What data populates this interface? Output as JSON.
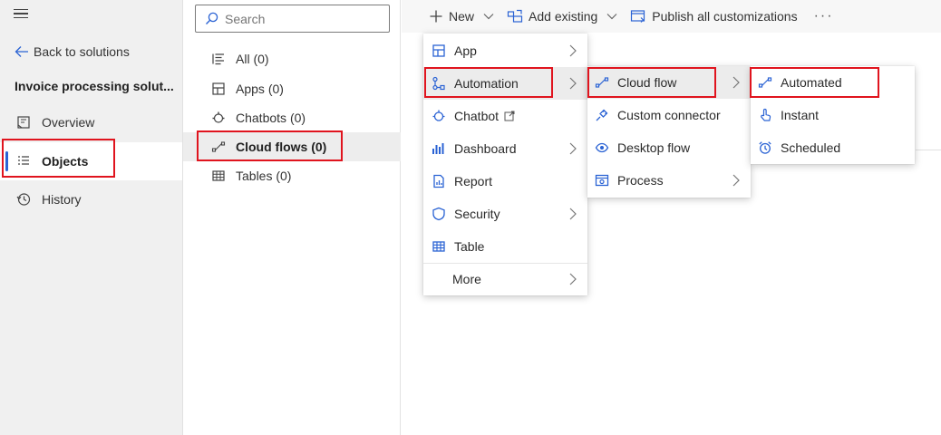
{
  "leftnav": {
    "back_label": "Back to solutions",
    "solution_title": "Invoice processing solut...",
    "items": [
      {
        "label": "Overview",
        "icon": "overview-icon"
      },
      {
        "label": "Objects",
        "icon": "objects-icon",
        "active": true
      },
      {
        "label": "History",
        "icon": "history-icon"
      }
    ]
  },
  "objects": {
    "search_placeholder": "Search",
    "items": [
      {
        "label": "All",
        "count": "(0)",
        "icon": "list-icon"
      },
      {
        "label": "Apps",
        "count": "(0)",
        "icon": "app-icon"
      },
      {
        "label": "Chatbots",
        "count": "(0)",
        "icon": "chatbot-icon"
      },
      {
        "label": "Cloud flows",
        "count": "(0)",
        "icon": "cloud-flow-icon",
        "active": true
      },
      {
        "label": "Tables",
        "count": "(0)",
        "icon": "table-icon"
      }
    ]
  },
  "commandbar": {
    "new_label": "New",
    "add_existing_label": "Add existing",
    "publish_label": "Publish all customizations",
    "more_label": "···"
  },
  "menu_new": {
    "items": [
      {
        "label": "App",
        "submenu": true
      },
      {
        "label": "Automation",
        "submenu": true,
        "highlighted": true
      },
      {
        "label": "Chatbot",
        "external": true
      },
      {
        "label": "Dashboard",
        "submenu": true
      },
      {
        "label": "Report"
      },
      {
        "label": "Security",
        "submenu": true
      },
      {
        "label": "Table"
      },
      {
        "label": "More",
        "submenu": true
      }
    ]
  },
  "menu_automation": {
    "items": [
      {
        "label": "Cloud flow",
        "submenu": true,
        "highlighted": true
      },
      {
        "label": "Custom connector"
      },
      {
        "label": "Desktop flow"
      },
      {
        "label": "Process",
        "submenu": true
      }
    ]
  },
  "menu_cloudflow": {
    "items": [
      {
        "label": "Automated"
      },
      {
        "label": "Instant"
      },
      {
        "label": "Scheduled"
      }
    ]
  },
  "colors": {
    "accent": "#2b63d4",
    "highlight_box": "#e0141e"
  }
}
